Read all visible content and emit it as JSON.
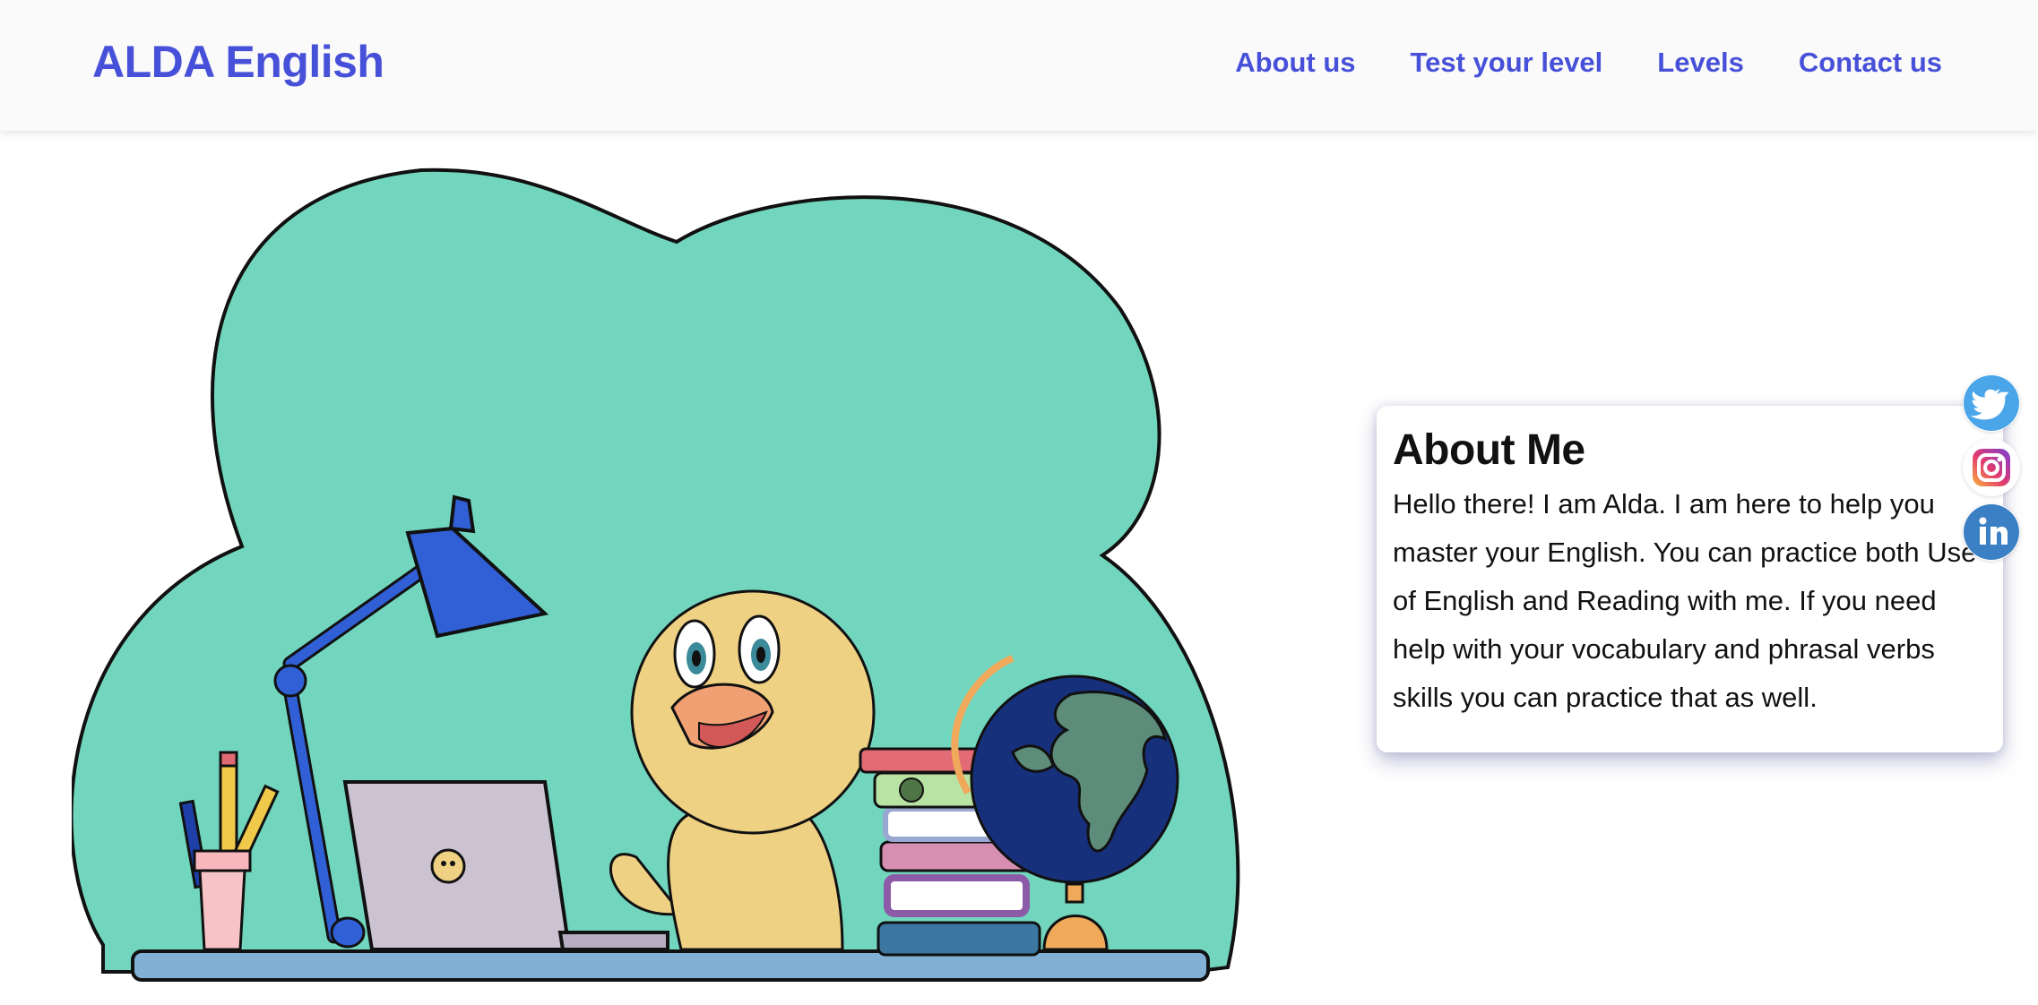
{
  "brand": {
    "title": "ALDA English"
  },
  "nav": {
    "items": [
      {
        "label": "About us"
      },
      {
        "label": "Test your level"
      },
      {
        "label": "Levels"
      },
      {
        "label": "Contact us"
      }
    ]
  },
  "about": {
    "heading": "About Me",
    "text": "Hello there! I am Alda. I am here to help you master your English. You can practice both Use of English and Reading with me. If you need help with your vocabulary and phrasal verbs skills you can practice that as well."
  },
  "social": {
    "items": [
      {
        "icon": "twitter-icon"
      },
      {
        "icon": "instagram-icon"
      },
      {
        "icon": "linkedin-icon"
      }
    ]
  },
  "illustration": {
    "laptop_logo": "duck"
  },
  "colors": {
    "brand": "#4750d8",
    "cloud": "#72d6bf",
    "duck": "#efd184",
    "desk": "#82b0d4",
    "globe_ocean": "#17307c",
    "lamp": "#3160d6"
  }
}
